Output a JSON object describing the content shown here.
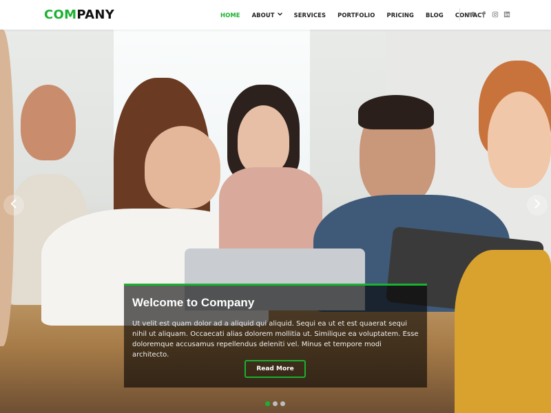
{
  "brand": {
    "logo_accent": "COM",
    "logo_rest": "PANY",
    "accent_color": "#1bb131"
  },
  "nav": {
    "items": [
      {
        "label": "HOME",
        "active": true
      },
      {
        "label": "ABOUT",
        "has_dropdown": true
      },
      {
        "label": "SERVICES"
      },
      {
        "label": "PORTFOLIO"
      },
      {
        "label": "PRICING"
      },
      {
        "label": "BLOG"
      },
      {
        "label": "CONTACT"
      }
    ],
    "dropdown_icon": "chevron-down-icon"
  },
  "social": [
    "twitter-icon",
    "facebook-icon",
    "instagram-icon",
    "linkedin-icon"
  ],
  "hero": {
    "title": "Welcome to Company",
    "body": "Ut velit est quam dolor ad a aliquid qui aliquid. Sequi ea ut et est quaerat sequi nihil ut aliquam. Occaecati alias dolorem mollitia ut. Similique ea voluptatem. Esse doloremque accusamus repellendus deleniti vel. Minus et tempore modi architecto.",
    "button_label": "Read More",
    "prev_icon": "chevron-left-icon",
    "next_icon": "chevron-right-icon",
    "slides_count": 3,
    "active_slide": 1
  }
}
